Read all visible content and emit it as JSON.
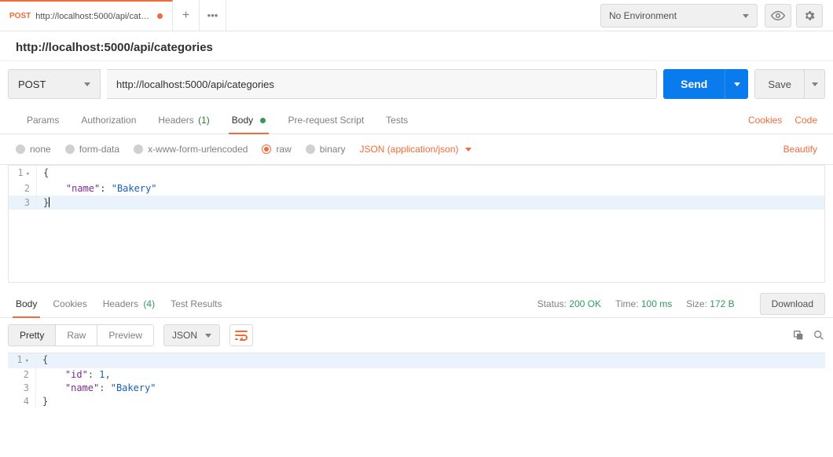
{
  "top": {
    "tab_method": "POST",
    "tab_title": "http://localhost:5000/api/categ...",
    "add_tab_glyph": "+",
    "more_glyph": "•••",
    "env_label": "No Environment"
  },
  "request": {
    "title": "http://localhost:5000/api/categories",
    "method": "POST",
    "url": "http://localhost:5000/api/categories",
    "send": "Send",
    "save": "Save"
  },
  "subtabs": {
    "params": "Params",
    "auth": "Authorization",
    "headers": "Headers",
    "headers_count": "(1)",
    "body": "Body",
    "prerequest": "Pre-request Script",
    "tests": "Tests",
    "cookies": "Cookies",
    "code": "Code"
  },
  "bodyTypes": {
    "none": "none",
    "formdata": "form-data",
    "urlencoded": "x-www-form-urlencoded",
    "raw": "raw",
    "binary": "binary",
    "mime": "JSON (application/json)",
    "beautify": "Beautify"
  },
  "reqEditor": {
    "l1_gut": "1",
    "l1_code": "{",
    "l2_gut": "2",
    "l2_key": "\"name\"",
    "l2_sep": ": ",
    "l2_val": "\"Bakery\"",
    "l3_gut": "3",
    "l3_code": "}"
  },
  "respTabs": {
    "body": "Body",
    "cookies": "Cookies",
    "headers": "Headers",
    "headers_count": "(4)",
    "testresults": "Test Results",
    "status_lbl": "Status:",
    "status_val": "200 OK",
    "time_lbl": "Time:",
    "time_val": "100 ms",
    "size_lbl": "Size:",
    "size_val": "172 B",
    "download": "Download"
  },
  "respView": {
    "pretty": "Pretty",
    "raw": "Raw",
    "preview": "Preview",
    "fmt": "JSON"
  },
  "respEditor": {
    "l1_gut": "1",
    "l1_code": "{",
    "l2_gut": "2",
    "l2_key": "\"id\"",
    "l2_sep": ": ",
    "l2_val": "1",
    "l2_comma": ",",
    "l3_gut": "3",
    "l3_key": "\"name\"",
    "l3_sep": ": ",
    "l3_val": "\"Bakery\"",
    "l4_gut": "4",
    "l4_code": "}"
  }
}
